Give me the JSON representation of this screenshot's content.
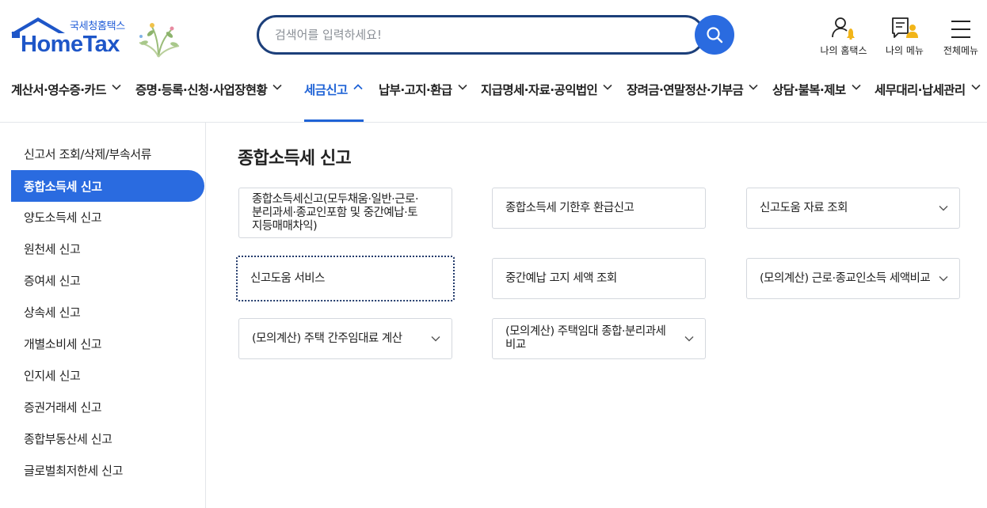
{
  "header": {
    "logo_sub": "국세청홈택스",
    "logo_main": "HomeTax",
    "search": {
      "placeholder": "검색어를 입력하세요!",
      "value": ""
    },
    "utils": [
      {
        "label": "나의 홈택스",
        "icon": "person-bell-icon"
      },
      {
        "label": "나의 메뉴",
        "icon": "document-person-icon"
      },
      {
        "label": "전체메뉴",
        "icon": "hamburger-icon"
      }
    ],
    "nav": [
      {
        "label": "계산서·영수증·카드",
        "active": false
      },
      {
        "label": "증명·등록·신청·사업장현황",
        "active": false
      },
      {
        "label": "세금신고",
        "active": true
      },
      {
        "label": "납부·고지·환급",
        "active": false
      },
      {
        "label": "지급명세·자료·공익법인",
        "active": false
      },
      {
        "label": "장려금·연말정산·기부금",
        "active": false
      },
      {
        "label": "상담·불복·제보",
        "active": false
      },
      {
        "label": "세무대리·납세관리",
        "active": false
      }
    ]
  },
  "sidebar": {
    "items": [
      {
        "label": "신고서 조회/삭제/부속서류"
      },
      {
        "label": "종합소득세 신고",
        "active": true
      },
      {
        "label": "양도소득세 신고"
      },
      {
        "label": "원천세 신고"
      },
      {
        "label": "증여세 신고"
      },
      {
        "label": "상속세 신고"
      },
      {
        "label": "개별소비세 신고"
      },
      {
        "label": "인지세 신고"
      },
      {
        "label": "증권거래세 신고"
      },
      {
        "label": "종합부동산세 신고"
      },
      {
        "label": "글로벌최저한세 신고"
      }
    ]
  },
  "main": {
    "title": "종합소득세 신고",
    "cards": [
      {
        "label": "종합소득세신고(모두채움·일반·근로·분리과세·종교인포함 및 중간예납·토지등매매차익)",
        "dropdown": false
      },
      {
        "label": "종합소득세 기한후 환급신고",
        "dropdown": false
      },
      {
        "label": "신고도움 자료 조회",
        "dropdown": true
      },
      {
        "label": "신고도움 서비스",
        "dropdown": false,
        "focused": true
      },
      {
        "label": "중간예납 고지 세액 조회",
        "dropdown": false
      },
      {
        "label": "(모의계산) 근로·종교인소득 세액비교",
        "dropdown": true
      },
      {
        "label": "(모의계산) 주택 간주임대료 계산",
        "dropdown": true
      },
      {
        "label": "(모의계산) 주택임대 종합·분리과세 비교",
        "dropdown": true
      }
    ]
  },
  "colors": {
    "accent": "#2a6be0",
    "active_nav": "#1f63d6",
    "search_border": "#1c3f7a"
  }
}
